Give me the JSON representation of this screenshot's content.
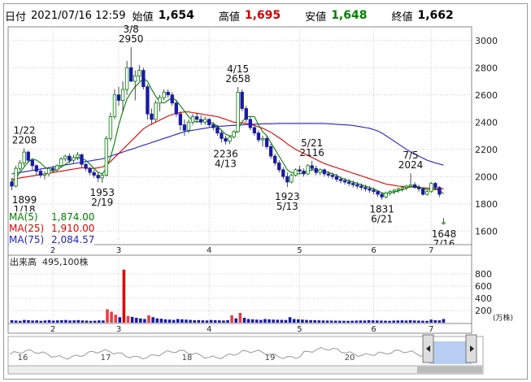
{
  "header": {
    "date_label": "日付",
    "datetime": "2021/07/16 12:59",
    "open_label": "始値",
    "open_value": "1,654",
    "high_label": "高値",
    "high_value": "1,695",
    "low_label": "安値",
    "low_value": "1,648",
    "close_label": "終値",
    "close_value": "1,662"
  },
  "legend": {
    "ma5_label": "MA(5)",
    "ma5_value": "1,874.00",
    "ma25_label": "MA(25)",
    "ma25_value": "1,910.00",
    "ma75_label": "MA(75)",
    "ma75_value": "2,084.57"
  },
  "volume_header": {
    "label": "出来高",
    "value": "495,100株",
    "unit": "(万株)"
  },
  "colors": {
    "up": "#008000",
    "down": "#1a1aa6",
    "ma5": "#008000",
    "ma25": "#e00000",
    "ma75": "#2222cc",
    "volume": "#1a1aa6",
    "volume_spike": "#e00000",
    "navigator_fill": "#aac4ee"
  },
  "chart_data": [
    {
      "type": "candlestick",
      "price_axis": {
        "min": 1500,
        "max": 3100,
        "ticks": [
          1600,
          1800,
          2000,
          2200,
          2400,
          2600,
          2800,
          3000
        ]
      },
      "month_labels": [
        "2",
        "3",
        "4",
        "5",
        "6",
        "7"
      ],
      "grid": true,
      "annotations": [
        {
          "date": "1/22",
          "price": "2208"
        },
        {
          "date": "1/18",
          "price": "1899"
        },
        {
          "date": "2/19",
          "price": "1953"
        },
        {
          "date": "3/8",
          "price": "2950"
        },
        {
          "date": "4/15",
          "price": "2658"
        },
        {
          "date": "4/13",
          "price": "2236"
        },
        {
          "date": "5/21",
          "price": "2116"
        },
        {
          "date": "5/13",
          "price": "1923"
        },
        {
          "date": "6/21",
          "price": "1831"
        },
        {
          "date": "7/5",
          "price": "2024"
        },
        {
          "date": "7/16",
          "price": "1648"
        }
      ],
      "ohlc": [
        [
          1,
          1960,
          1990,
          1899,
          1930
        ],
        [
          2,
          1930,
          2080,
          1920,
          2060
        ],
        [
          3,
          2060,
          2120,
          2040,
          2100
        ],
        [
          4,
          2100,
          2208,
          2080,
          2180
        ],
        [
          5,
          2180,
          2190,
          2100,
          2120
        ],
        [
          6,
          2120,
          2130,
          2050,
          2080
        ],
        [
          7,
          2080,
          2090,
          2010,
          2040
        ],
        [
          8,
          2040,
          2060,
          1990,
          2010
        ],
        [
          9,
          2010,
          2040,
          1980,
          2020
        ],
        [
          10,
          2020,
          2070,
          2000,
          2060
        ],
        [
          11,
          2060,
          2080,
          2030,
          2050
        ],
        [
          12,
          2050,
          2090,
          2040,
          2080
        ],
        [
          13,
          2080,
          2140,
          2070,
          2130
        ],
        [
          14,
          2130,
          2160,
          2110,
          2150
        ],
        [
          15,
          2150,
          2170,
          2100,
          2120
        ],
        [
          16,
          2120,
          2160,
          2100,
          2140
        ],
        [
          17,
          2140,
          2180,
          2120,
          2160
        ],
        [
          18,
          2160,
          2170,
          2070,
          2090
        ],
        [
          19,
          2090,
          2100,
          2040,
          2060
        ],
        [
          20,
          2060,
          2070,
          2010,
          2030
        ],
        [
          21,
          2030,
          2050,
          1990,
          2010
        ],
        [
          22,
          2010,
          2030,
          1960,
          1990
        ],
        [
          23,
          1990,
          2020,
          1953,
          2010
        ],
        [
          24,
          2010,
          2300,
          2000,
          2280
        ],
        [
          25,
          2280,
          2470,
          2260,
          2440
        ],
        [
          26,
          2440,
          2640,
          2420,
          2600
        ],
        [
          27,
          2600,
          2660,
          2520,
          2560
        ],
        [
          28,
          2560,
          2700,
          2480,
          2640
        ],
        [
          29,
          2640,
          2850,
          2600,
          2800
        ],
        [
          30,
          2800,
          2950,
          2740,
          2700
        ],
        [
          31,
          2700,
          2780,
          2560,
          2740
        ],
        [
          32,
          2740,
          2820,
          2700,
          2780
        ],
        [
          33,
          2780,
          2800,
          2640,
          2660
        ],
        [
          34,
          2660,
          2680,
          2420,
          2460
        ],
        [
          35,
          2460,
          2500,
          2380,
          2420
        ],
        [
          36,
          2420,
          2560,
          2400,
          2540
        ],
        [
          37,
          2540,
          2600,
          2480,
          2580
        ],
        [
          38,
          2580,
          2640,
          2560,
          2620
        ],
        [
          39,
          2620,
          2640,
          2580,
          2600
        ],
        [
          40,
          2600,
          2620,
          2520,
          2540
        ],
        [
          41,
          2540,
          2560,
          2440,
          2460
        ],
        [
          42,
          2460,
          2480,
          2340,
          2380
        ],
        [
          43,
          2380,
          2420,
          2300,
          2340
        ],
        [
          44,
          2340,
          2420,
          2320,
          2400
        ],
        [
          45,
          2400,
          2460,
          2380,
          2440
        ],
        [
          46,
          2440,
          2470,
          2400,
          2420
        ],
        [
          47,
          2420,
          2450,
          2380,
          2400
        ],
        [
          48,
          2400,
          2440,
          2380,
          2420
        ],
        [
          49,
          2420,
          2430,
          2360,
          2380
        ],
        [
          50,
          2380,
          2400,
          2340,
          2360
        ],
        [
          51,
          2360,
          2380,
          2300,
          2320
        ],
        [
          52,
          2320,
          2340,
          2250,
          2280
        ],
        [
          53,
          2280,
          2300,
          2236,
          2260
        ],
        [
          54,
          2260,
          2300,
          2240,
          2290
        ],
        [
          55,
          2290,
          2340,
          2280,
          2330
        ],
        [
          56,
          2330,
          2658,
          2320,
          2620
        ],
        [
          57,
          2620,
          2640,
          2480,
          2500
        ],
        [
          58,
          2500,
          2520,
          2400,
          2420
        ],
        [
          59,
          2420,
          2440,
          2340,
          2360
        ],
        [
          60,
          2360,
          2380,
          2300,
          2320
        ],
        [
          61,
          2320,
          2340,
          2250,
          2270
        ],
        [
          62,
          2270,
          2300,
          2220,
          2280
        ],
        [
          63,
          2280,
          2300,
          2200,
          2220
        ],
        [
          64,
          2220,
          2240,
          2130,
          2150
        ],
        [
          65,
          2150,
          2170,
          2080,
          2100
        ],
        [
          66,
          2100,
          2120,
          2030,
          2050
        ],
        [
          67,
          2050,
          2070,
          1980,
          2000
        ],
        [
          68,
          2000,
          2030,
          1923,
          1960
        ],
        [
          69,
          1960,
          2020,
          1950,
          2010
        ],
        [
          70,
          2010,
          2060,
          2000,
          2050
        ],
        [
          71,
          2050,
          2080,
          2020,
          2040
        ],
        [
          72,
          2040,
          2060,
          2000,
          2020
        ],
        [
          73,
          2020,
          2090,
          2010,
          2080
        ],
        [
          74,
          2080,
          2116,
          2040,
          2060
        ],
        [
          75,
          2060,
          2080,
          2010,
          2030
        ],
        [
          76,
          2030,
          2060,
          2010,
          2050
        ],
        [
          77,
          2050,
          2060,
          2000,
          2020
        ],
        [
          78,
          2020,
          2040,
          1990,
          2010
        ],
        [
          79,
          2010,
          2030,
          1980,
          2000
        ],
        [
          80,
          2000,
          2020,
          1960,
          1980
        ],
        [
          81,
          1980,
          2000,
          1950,
          1970
        ],
        [
          82,
          1970,
          1990,
          1940,
          1960
        ],
        [
          83,
          1960,
          1980,
          1930,
          1950
        ],
        [
          84,
          1950,
          1970,
          1920,
          1940
        ],
        [
          85,
          1940,
          1960,
          1910,
          1930
        ],
        [
          86,
          1930,
          1950,
          1900,
          1920
        ],
        [
          87,
          1920,
          1940,
          1890,
          1910
        ],
        [
          88,
          1910,
          1930,
          1880,
          1900
        ],
        [
          89,
          1900,
          1920,
          1870,
          1890
        ],
        [
          90,
          1890,
          1900,
          1850,
          1870
        ],
        [
          91,
          1870,
          1880,
          1831,
          1850
        ],
        [
          92,
          1850,
          1890,
          1840,
          1880
        ],
        [
          93,
          1880,
          1900,
          1860,
          1890
        ],
        [
          94,
          1890,
          1910,
          1870,
          1900
        ],
        [
          95,
          1900,
          1920,
          1880,
          1910
        ],
        [
          96,
          1910,
          1930,
          1890,
          1920
        ],
        [
          97,
          1920,
          1940,
          1900,
          1930
        ],
        [
          98,
          1930,
          2024,
          1920,
          1940
        ],
        [
          99,
          1940,
          1960,
          1910,
          1920
        ],
        [
          100,
          1920,
          1940,
          1890,
          1910
        ],
        [
          101,
          1910,
          1920,
          1860,
          1870
        ],
        [
          102,
          1870,
          1900,
          1860,
          1890
        ],
        [
          103,
          1890,
          1960,
          1880,
          1950
        ],
        [
          104,
          1950,
          1960,
          1900,
          1920
        ],
        [
          105,
          1920,
          1930,
          1850,
          1870
        ],
        [
          106,
          1654,
          1695,
          1648,
          1662
        ]
      ],
      "ma5": [
        1960,
        1990,
        2030,
        2070,
        2108,
        2130,
        2120,
        2100,
        2070,
        2050,
        2040,
        2050,
        2070,
        2090,
        2110,
        2130,
        2140,
        2130,
        2120,
        2090,
        2060,
        2030,
        2020,
        2060,
        2140,
        2250,
        2380,
        2480,
        2570,
        2620,
        2660,
        2690,
        2720,
        2700,
        2640,
        2590,
        2550,
        2540,
        2560,
        2580,
        2560,
        2520,
        2480,
        2440,
        2410,
        2400,
        2410,
        2410,
        2400,
        2390,
        2370,
        2340,
        2310,
        2300,
        2300,
        2350,
        2400,
        2440,
        2440,
        2440,
        2380,
        2330,
        2300,
        2250,
        2200,
        2150,
        2100,
        2050,
        2030,
        2020,
        2020,
        2030,
        2040,
        2050,
        2050,
        2040,
        2040,
        2030,
        2020,
        2010,
        1990,
        1980,
        1970,
        1960,
        1950,
        1940,
        1930,
        1920,
        1910,
        1895,
        1880,
        1875,
        1880,
        1885,
        1895,
        1905,
        1915,
        1925,
        1930,
        1925,
        1915,
        1905,
        1905,
        1905,
        1900,
        1874
      ],
      "ma25": [
        1980,
        1985,
        1990,
        1995,
        2000,
        2005,
        2010,
        2015,
        2020,
        2025,
        2030,
        2035,
        2040,
        2045,
        2050,
        2055,
        2060,
        2065,
        2065,
        2060,
        2060,
        2065,
        2070,
        2085,
        2110,
        2140,
        2170,
        2200,
        2230,
        2260,
        2290,
        2320,
        2350,
        2370,
        2385,
        2400,
        2415,
        2430,
        2445,
        2455,
        2465,
        2470,
        2475,
        2475,
        2470,
        2465,
        2460,
        2455,
        2450,
        2445,
        2440,
        2430,
        2420,
        2410,
        2400,
        2395,
        2395,
        2390,
        2385,
        2375,
        2365,
        2355,
        2340,
        2325,
        2305,
        2285,
        2265,
        2240,
        2220,
        2200,
        2185,
        2170,
        2155,
        2140,
        2125,
        2110,
        2095,
        2085,
        2075,
        2065,
        2055,
        2045,
        2035,
        2025,
        2015,
        2005,
        1995,
        1985,
        1975,
        1965,
        1955,
        1945,
        1940,
        1935,
        1930,
        1928,
        1926,
        1924,
        1922,
        1920,
        1918,
        1916,
        1914,
        1912,
        1911,
        1910
      ],
      "ma75": [
        2020,
        2025,
        2030,
        2035,
        2040,
        2045,
        2050,
        2055,
        2060,
        2065,
        2070,
        2075,
        2080,
        2085,
        2090,
        2095,
        2100,
        2105,
        2110,
        2115,
        2120,
        2125,
        2130,
        2140,
        2150,
        2160,
        2170,
        2180,
        2190,
        2200,
        2210,
        2220,
        2230,
        2240,
        2250,
        2260,
        2270,
        2280,
        2290,
        2300,
        2310,
        2320,
        2330,
        2335,
        2340,
        2345,
        2350,
        2355,
        2360,
        2365,
        2370,
        2370,
        2372,
        2374,
        2376,
        2378,
        2380,
        2382,
        2384,
        2385,
        2386,
        2387,
        2388,
        2388,
        2389,
        2390,
        2390,
        2390,
        2390,
        2390,
        2390,
        2390,
        2390,
        2390,
        2390,
        2390,
        2390,
        2388,
        2386,
        2384,
        2382,
        2380,
        2378,
        2375,
        2370,
        2365,
        2360,
        2355,
        2345,
        2335,
        2320,
        2300,
        2280,
        2260,
        2240,
        2220,
        2200,
        2180,
        2165,
        2150,
        2135,
        2120,
        2110,
        2100,
        2092,
        2084.57
      ]
    },
    {
      "type": "bar",
      "name_hint": "volume",
      "y_axis": {
        "min": 0,
        "max": 1000,
        "ticks": [
          200,
          400,
          600,
          800
        ]
      },
      "month_labels": [
        "2",
        "3",
        "4",
        "5",
        "6",
        "7"
      ],
      "values": [
        40,
        35,
        30,
        45,
        40,
        35,
        38,
        30,
        36,
        42,
        34,
        38,
        40,
        44,
        36,
        38,
        42,
        36,
        34,
        30,
        32,
        38,
        36,
        220,
        180,
        130,
        90,
        870,
        110,
        95,
        80,
        70,
        60,
        120,
        90,
        70,
        65,
        55,
        50,
        45,
        60,
        55,
        50,
        45,
        40,
        42,
        38,
        36,
        44,
        40,
        38,
        36,
        40,
        120,
        70,
        160,
        80,
        60,
        55,
        50,
        45,
        60,
        55,
        50,
        48,
        46,
        44,
        90,
        60,
        55,
        50,
        45,
        42,
        40,
        38,
        36,
        35,
        34,
        33,
        32,
        31,
        30,
        32,
        34,
        36,
        35,
        40,
        38,
        36,
        34,
        32,
        30,
        34,
        36,
        38,
        35,
        40,
        36,
        34,
        32,
        30,
        50,
        40,
        38,
        60
      ]
    },
    {
      "type": "area",
      "name_hint": "navigator",
      "labels": [
        "16",
        "17",
        "18",
        "19",
        "20"
      ]
    }
  ]
}
